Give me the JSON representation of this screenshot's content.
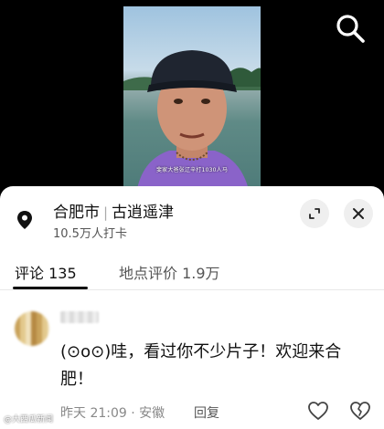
{
  "video": {
    "caption": "斐家大爸张辽辛打1030人马"
  },
  "location": {
    "city": "合肥市",
    "place": "古逍遥津",
    "checkins": "10.5万人打卡"
  },
  "tabs": [
    {
      "label": "评论 135",
      "active": true
    },
    {
      "label": "地点评价 1.9万",
      "active": false
    }
  ],
  "comment": {
    "text": "(⊙o⊙)哇，看过你不少片子！欢迎来合肥！",
    "time": "昨天 21:09",
    "region": "安徽",
    "reply_label": "回复"
  },
  "watermark": "@大西瓜新闻",
  "icons": {
    "search": "search-icon",
    "location": "location-pin-icon",
    "expand": "expand-icon",
    "close": "close-icon",
    "like": "heart-icon",
    "dislike": "broken-heart-icon"
  },
  "colors": {
    "sheet_bg": "#ffffff",
    "text_primary": "#111111",
    "text_secondary": "#888888",
    "button_bg": "#efefef"
  }
}
